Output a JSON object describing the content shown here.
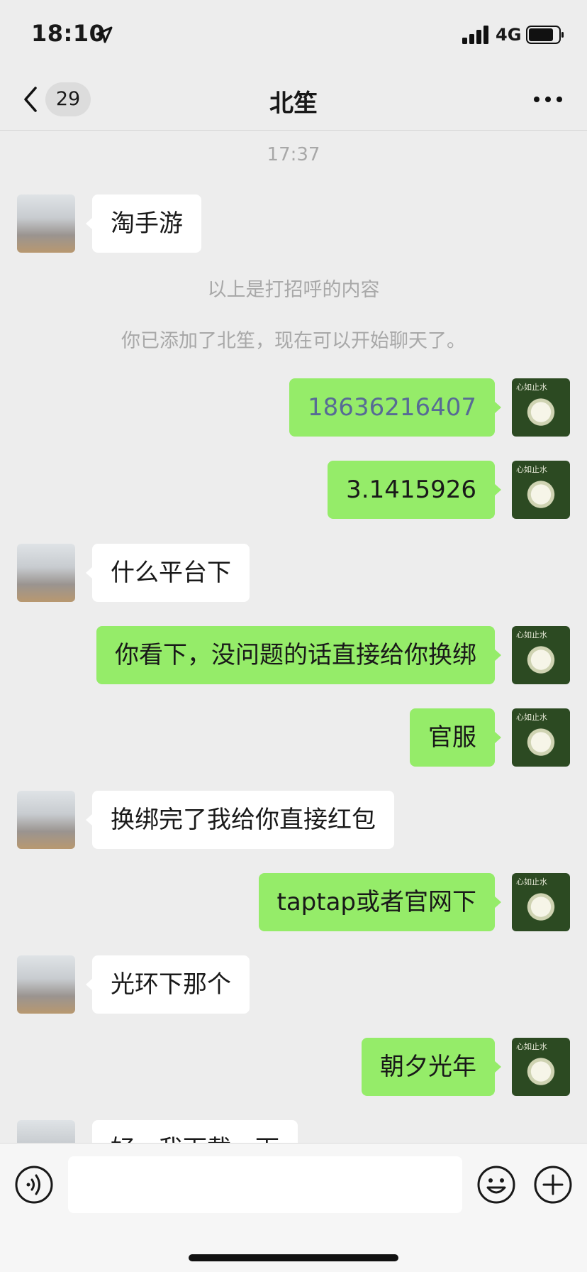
{
  "status_bar": {
    "time": "18:10",
    "network": "4G"
  },
  "nav": {
    "unread_count": "29",
    "title": "北笙"
  },
  "chat": {
    "timestamp": "17:37",
    "greeting_note": "以上是打招呼的内容",
    "added_note": "你已添加了北笙，现在可以开始聊天了。",
    "messages": [
      {
        "side": "left",
        "text": "淘手游"
      },
      {
        "side": "right",
        "text": "18636216407"
      },
      {
        "side": "right",
        "text": "3.1415926"
      },
      {
        "side": "left",
        "text": "什么平台下"
      },
      {
        "side": "right",
        "text": "你看下，没问题的话直接给你换绑"
      },
      {
        "side": "right",
        "text": "官服"
      },
      {
        "side": "left",
        "text": "换绑完了我给你直接红包"
      },
      {
        "side": "right",
        "text": "taptap或者官网下"
      },
      {
        "side": "left",
        "text": "光环下那个"
      },
      {
        "side": "right",
        "text": "朝夕光年"
      },
      {
        "side": "left",
        "text": "好，我下载一下"
      }
    ]
  },
  "avatars": {
    "self_caption": "心如止水"
  },
  "colors": {
    "self_bubble": "#95ec69",
    "other_bubble": "#ffffff",
    "background": "#ededed",
    "link_text": "#576b95"
  },
  "icons": [
    "location-arrow-icon",
    "signal-icon",
    "battery-icon",
    "back-chevron-icon",
    "more-icon",
    "voice-icon",
    "emoji-icon",
    "plus-icon"
  ]
}
